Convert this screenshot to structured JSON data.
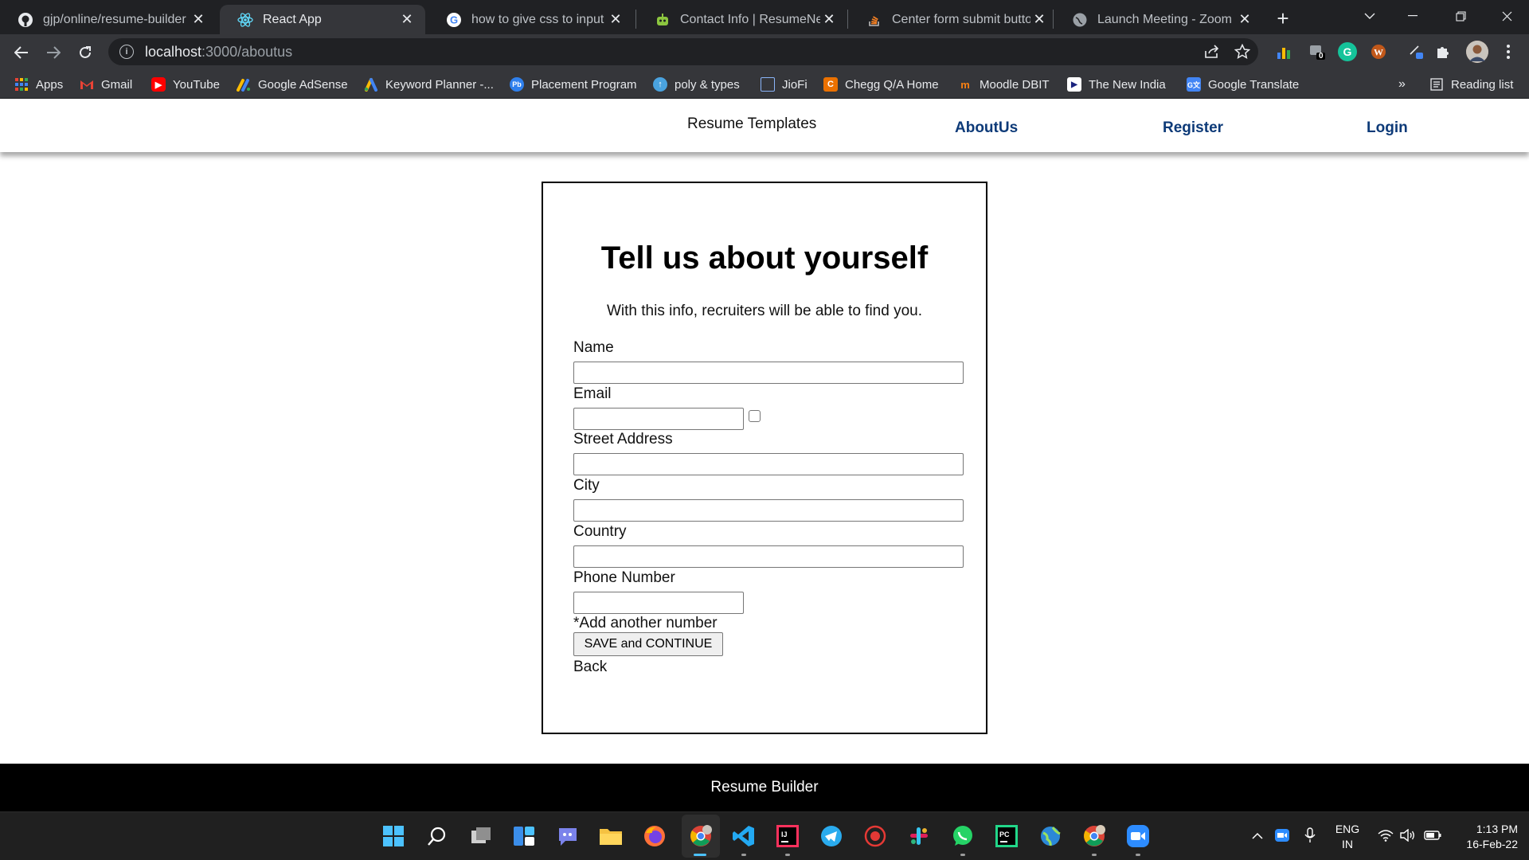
{
  "browser": {
    "tabs": [
      {
        "title": "gjp/online/resume-builder",
        "icon": "github-icon",
        "active": false
      },
      {
        "title": "React App",
        "icon": "react-icon",
        "active": true
      },
      {
        "title": "how to give css to input in f",
        "icon": "google-icon",
        "active": false
      },
      {
        "title": "Contact Info | ResumeNerd",
        "icon": "resumenerd-icon",
        "active": false
      },
      {
        "title": "Center form submit button",
        "icon": "stackoverflow-icon",
        "active": false
      },
      {
        "title": "Launch Meeting - Zoom",
        "icon": "globe-icon",
        "active": false
      }
    ],
    "url_host": "localhost",
    "url_path": ":3000/aboutus",
    "bookmarks": [
      {
        "label": "Apps",
        "icon": "apps-grid-icon"
      },
      {
        "label": "Gmail",
        "icon": "gmail-icon"
      },
      {
        "label": "YouTube",
        "icon": "youtube-icon"
      },
      {
        "label": "Google AdSense",
        "icon": "adsense-icon"
      },
      {
        "label": "Keyword Planner -...",
        "icon": "google-ads-icon"
      },
      {
        "label": "Placement Program",
        "icon": "pb-icon"
      },
      {
        "label": "poly & types",
        "icon": "upload-cloud-icon"
      },
      {
        "label": "JioFi",
        "icon": "jiofi-icon"
      },
      {
        "label": "Chegg Q/A Home",
        "icon": "chegg-icon"
      },
      {
        "label": "Moodle DBIT",
        "icon": "moodle-icon"
      },
      {
        "label": "The New India",
        "icon": "newindia-icon"
      },
      {
        "label": "Google Translate",
        "icon": "translate-icon"
      }
    ],
    "bookmarks_overflow": "»",
    "reading_list": "Reading list",
    "extension_badge": "0"
  },
  "site_nav": {
    "templates": "Resume Templates",
    "about": "AboutUs",
    "register": "Register",
    "login": "Login"
  },
  "form": {
    "title": "Tell us about yourself",
    "subtitle": "With this info, recruiters will be able to find you.",
    "labels": {
      "name": "Name",
      "email": "Email",
      "street": "Street Address",
      "city": "City",
      "country": "Country",
      "phone": "Phone Number"
    },
    "values": {
      "name": "",
      "email": "",
      "street": "",
      "city": "",
      "country": "",
      "phone": ""
    },
    "add_number": "*Add another number",
    "submit": "SAVE and CONTINUE",
    "back": "Back"
  },
  "footer": {
    "text": "Resume Builder"
  },
  "taskbar": {
    "lang_line1": "ENG",
    "lang_line2": "IN",
    "time": "1:13 PM",
    "date": "16-Feb-22"
  },
  "colors": {
    "nav_link": "#0d3a78",
    "footer_bg": "#000000",
    "chrome_dark": "#202124",
    "chrome_toolbar": "#35363a"
  }
}
